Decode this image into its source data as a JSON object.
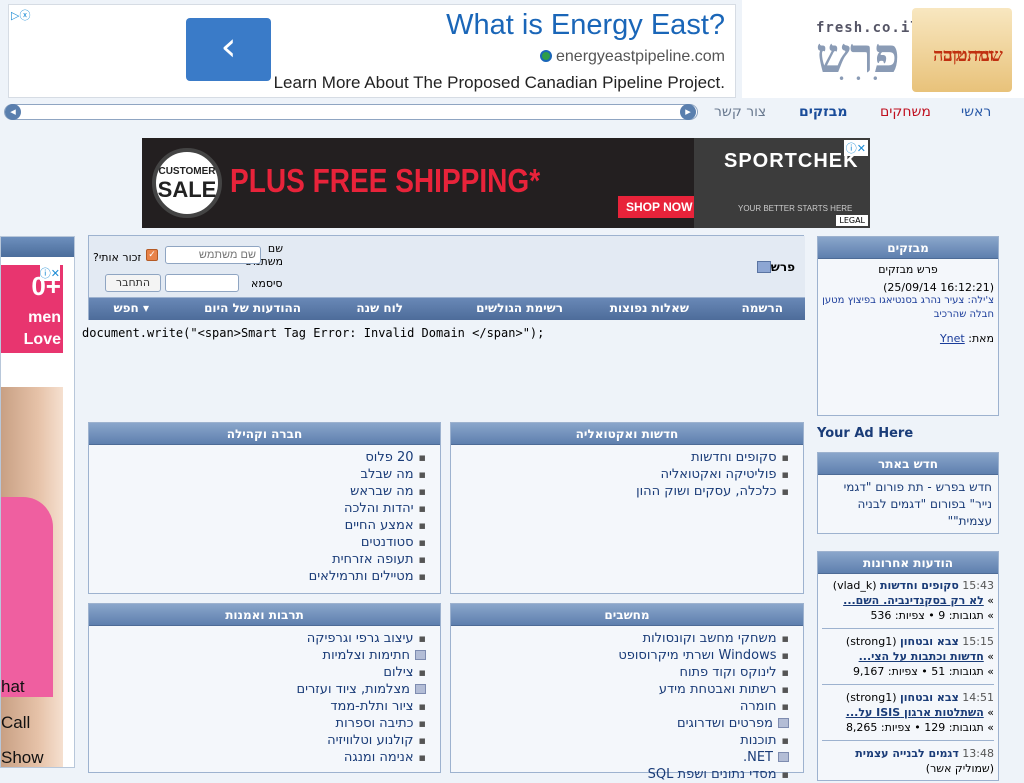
{
  "top_ad": {
    "title": "What is Energy East?",
    "domain": "energyeastpipeline.com",
    "text": "Learn More About The Proposed Canadian Pipeline Project.",
    "arrow": "‹",
    "icons": "▷ⓧ"
  },
  "logo": {
    "site_url": "fresh.co.il",
    "site_name": "פרש",
    "badge_line1": "שנה טובה",
    "badge_line2": "ומתוקה"
  },
  "nav": {
    "home": "ראשי",
    "games": "משחקים",
    "deals": "מבזקים",
    "contact": "צור קשר",
    "arrow_left": "◂",
    "arrow_right": "▸"
  },
  "mid_ad": {
    "sale_top": "CUSTOMER",
    "sale_mid": "SALE",
    "headline": "PLUS FREE SHIPPING*",
    "cta": "SHOP NOW",
    "brand": "SPORTCHEK",
    "tagline": "YOUR BETTER STARTS HERE",
    "legal": "LEGAL",
    "close": "ⓘ✕"
  },
  "left_ad": {
    "line1": "0+",
    "line2": "men",
    "line3": "Love",
    "label_hat": "hat",
    "label_call": "Call",
    "label_show": "Show",
    "icons": "ⓘ✕"
  },
  "login": {
    "site_title": "פרש",
    "username_label": "שם משתמש",
    "username_placeholder": "שם משתמש",
    "remember_label": "זכור אותי?",
    "password_label": "סיסמא",
    "login_button": "התחבר",
    "tabs": [
      "הרשמה",
      "שאלות נפוצות",
      "רשימת הגולשים",
      "לוח שנה",
      "ההודעות של היום",
      "חפש ▾"
    ]
  },
  "smart_tag": "document.write(\"<span>Smart Tag Error: Invalid Domain </span>\");",
  "forums": {
    "news": {
      "title": "חדשות ואקטואליה",
      "items": [
        "סקופים וחדשות",
        "פוליטיקה ואקטואליה",
        "כלכלה, עסקים ושוק ההון"
      ]
    },
    "society": {
      "title": "חברה וקהילה",
      "items": [
        "20 פלוס",
        "מה שבלב",
        "מה שבראש",
        "יהדות והלכה",
        "אמצע החיים",
        "סטודנטים",
        "תעופה אזרחית",
        "מטיילים ותרמילאים"
      ]
    },
    "computers": {
      "title": "מחשבים",
      "items": [
        "משחקי מחשב וקונסולות",
        "Windows ושרתי מיקרוסופט",
        "לינוקס וקוד פתוח",
        "רשתות ואבטחת מידע",
        "חומרה",
        "מפרטים ושדרוגים",
        "תוכנות",
        "NET.",
        "מסדי נתונים ושפת SQL"
      ]
    },
    "culture": {
      "title": "תרבות ואמנות",
      "items": [
        "עיצוב גרפי וגרפיקה",
        "חתימות וצלמיות",
        "צילום",
        "מצלמות, ציוד ועזרים",
        "ציור ותלת-ממד",
        "כתיבה וספרות",
        "קולנוע וטלוויזיה",
        "אנימה ומנגה"
      ]
    }
  },
  "sidebar": {
    "flash_title": "מבזקים",
    "flash_sub": "פרש מבזקים",
    "flash_date": "(25/09/14 16:12:21)",
    "flash_link": "צ'ילה: צעיר נהרג בסנטיאגו בפיצוץ מטען חבלה שהרכיב",
    "flash_source_label": "מאת:",
    "flash_source": "Ynet",
    "your_ad": "Your Ad Here",
    "new_title": "חדש באתר",
    "new_text": "חדש בפרש - תת פורום \"דגמי נייר\" בפורום \"דגמים לבניה עצמית\"\"",
    "latest_title": "הודעות אחרונות",
    "posts": [
      {
        "time": "15:43",
        "forum": "סקופים וחדשות",
        "user": "(vlad_k)",
        "title": "לא רק בסקנדינביה. השם...",
        "stats": "» תגובות: 9 • צפיות: 536"
      },
      {
        "time": "15:15",
        "forum": "צבא ובטחון",
        "user": "(strong1)",
        "title": "חדשות וכתבות על הצי...",
        "stats": "» תגובות: 51 • צפיות: 9,167"
      },
      {
        "time": "14:51",
        "forum": "צבא ובטחון",
        "user": "(strong1)",
        "title": "השתלטות ארגון ISIS על...",
        "stats": "» תגובות: 129 • צפיות: 8,265"
      },
      {
        "time": "13:48",
        "forum": "דגמים לבנייה עצמית",
        "user": "(שמוליק אשר)",
        "title": "",
        "stats": ""
      }
    ]
  }
}
